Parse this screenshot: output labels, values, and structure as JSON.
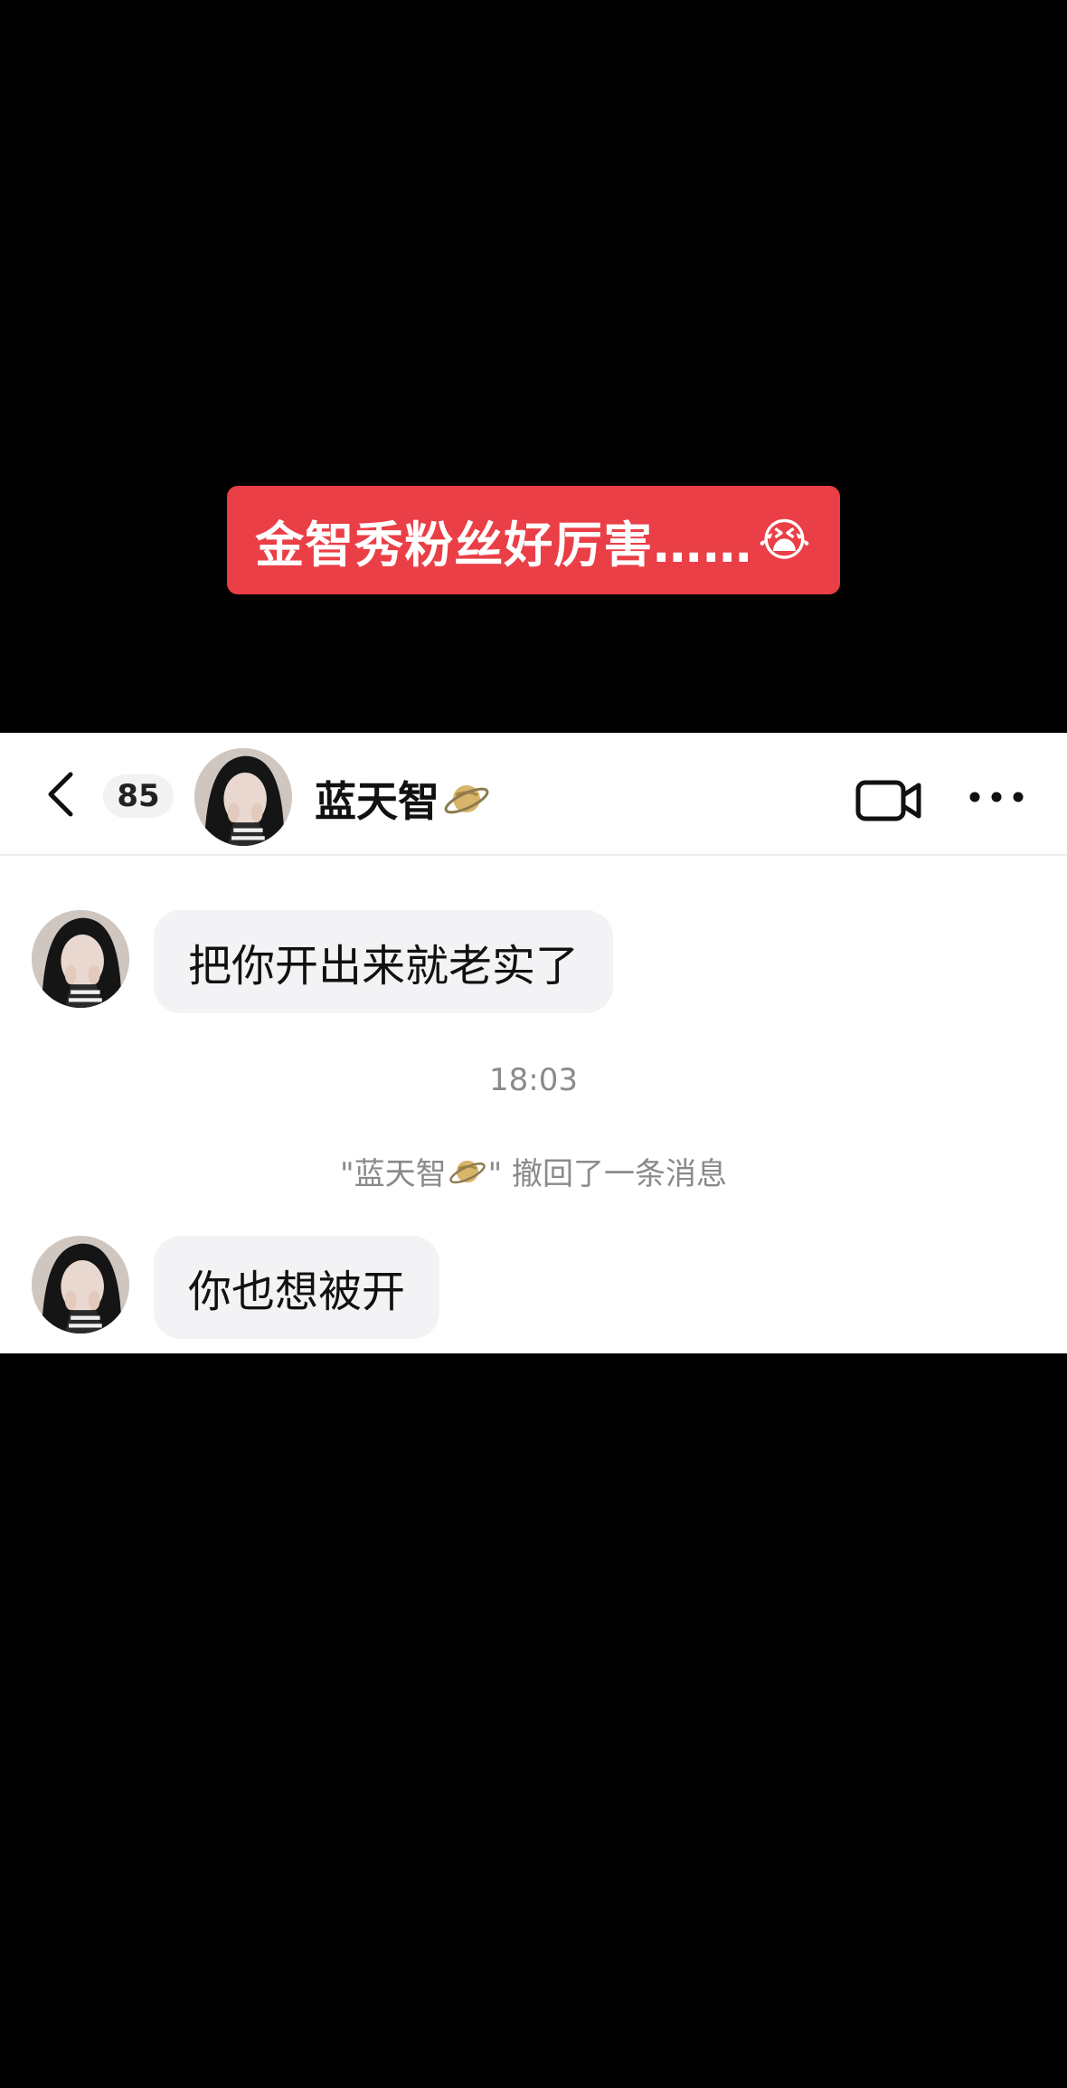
{
  "overlay": {
    "caption": "金智秀粉丝好厉害……",
    "caption_emoji": "😭"
  },
  "header": {
    "back_icon": "chevron-left-icon",
    "unread_count": "85",
    "contact_name": "蓝天智",
    "name_icon": "saturn-icon",
    "video_icon": "video-camera-icon",
    "more_icon": "more-dots-icon"
  },
  "messages": [
    {
      "sender": "蓝天智",
      "text": "把你开出来就老实了"
    },
    {
      "sender": "蓝天智",
      "text": "你也想被开"
    }
  ],
  "timestamp": "18:03",
  "recall_notice": {
    "open_quote": "\"蓝天智",
    "close_text": "\" 撤回了一条消息"
  },
  "colors": {
    "caption_bg": "#ea3f46",
    "bubble_bg": "#f3f3f5",
    "meta_text": "#8a8a8a"
  }
}
